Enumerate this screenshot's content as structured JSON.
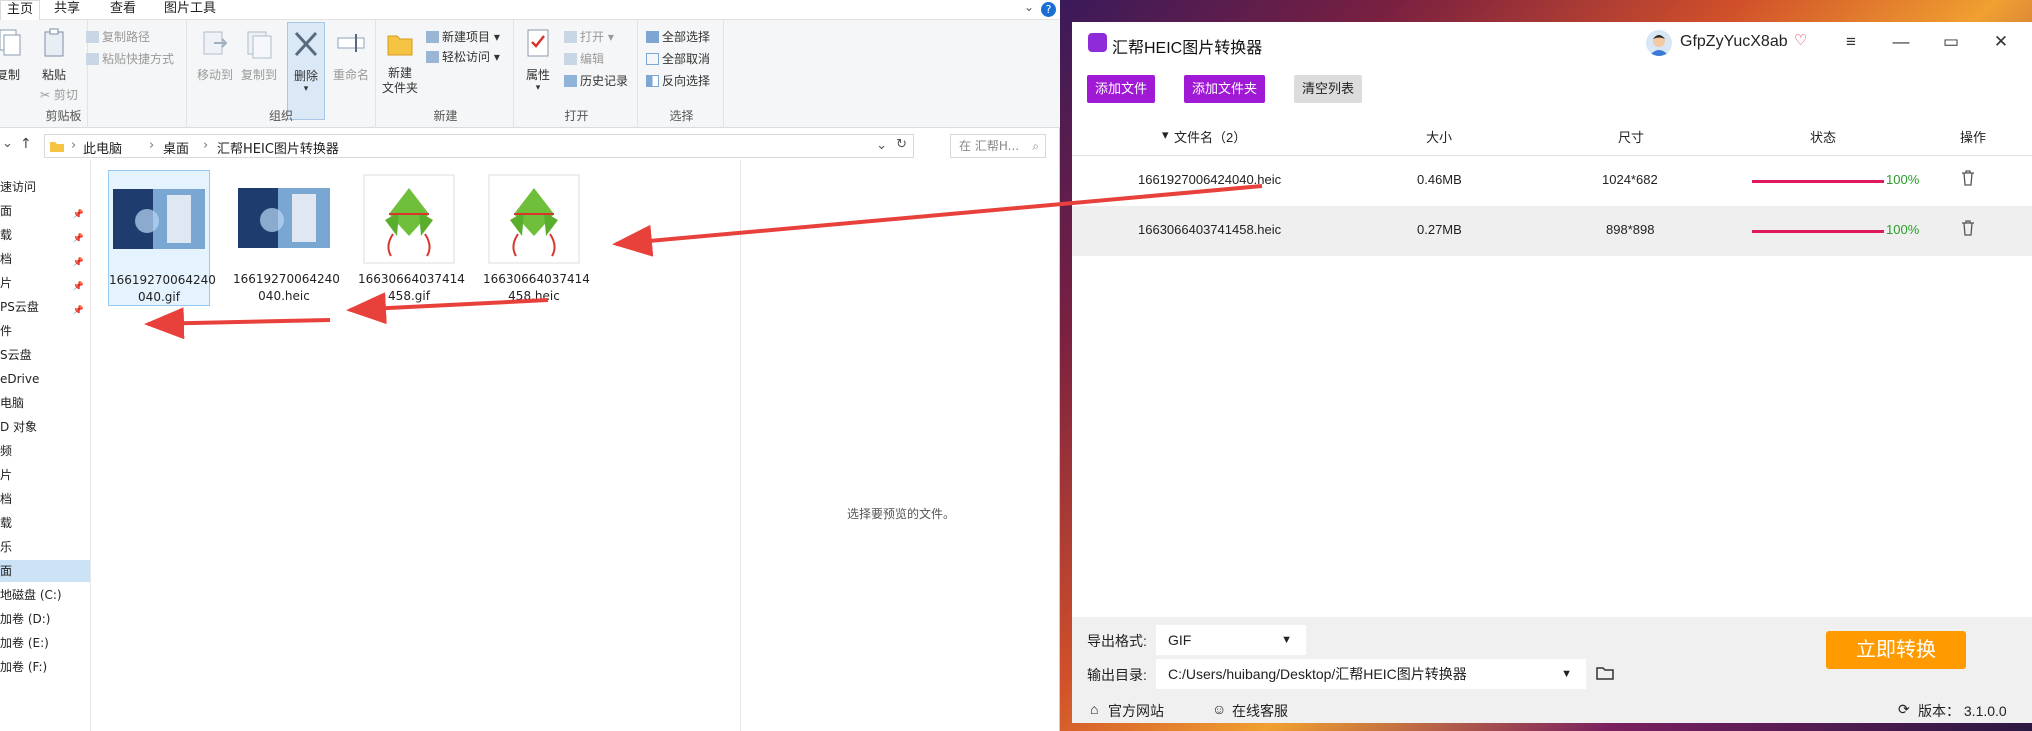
{
  "explorer": {
    "tabs": [
      {
        "label": "主页"
      },
      {
        "label": "共享"
      },
      {
        "label": "查看"
      },
      {
        "label": "图片工具"
      }
    ],
    "ribbon": {
      "clipboard": {
        "copy": "复制",
        "paste": "粘贴",
        "copy_path": "复制路径",
        "paste_shortcut": "粘贴快捷方式",
        "cut": "剪切",
        "group": "剪贴板"
      },
      "organize": {
        "move_to": "移动到",
        "copy_to": "复制到",
        "delete": "删除",
        "rename": "重命名",
        "group": "组织"
      },
      "new": {
        "new_folder": "新建\n文件夹",
        "new_item": "新建项目",
        "easy_access": "轻松访问",
        "group": "新建"
      },
      "open": {
        "properties": "属性",
        "open": "打开",
        "edit": "编辑",
        "history": "历史记录",
        "group": "打开"
      },
      "select": {
        "select_all": "全部选择",
        "select_none": "全部取消",
        "invert": "反向选择",
        "group": "选择"
      }
    },
    "address": {
      "crumbs": [
        "此电脑",
        "桌面",
        "汇帮HEIC图片转换器"
      ],
      "search_placeholder": "在 汇帮H..."
    },
    "nav": [
      {
        "label": "速访问",
        "pinned": false
      },
      {
        "label": "面",
        "pinned": true
      },
      {
        "label": "载",
        "pinned": true
      },
      {
        "label": "档",
        "pinned": true
      },
      {
        "label": "片",
        "pinned": true
      },
      {
        "label": "PS云盘",
        "pinned": true
      },
      {
        "label": "件",
        "pinned": false
      },
      {
        "label": "S云盘",
        "pinned": false
      },
      {
        "label": "eDrive",
        "pinned": false
      },
      {
        "label": "电脑",
        "pinned": false
      },
      {
        "label": "D 对象",
        "pinned": false
      },
      {
        "label": "频",
        "pinned": false
      },
      {
        "label": "片",
        "pinned": false
      },
      {
        "label": "档",
        "pinned": false
      },
      {
        "label": "载",
        "pinned": false
      },
      {
        "label": "乐",
        "pinned": false
      },
      {
        "label": "面",
        "pinned": false
      },
      {
        "label": "地磁盘 (C:)",
        "pinned": false
      },
      {
        "label": "加卷 (D:)",
        "pinned": false
      },
      {
        "label": "加卷 (E:)",
        "pinned": false
      },
      {
        "label": "加卷 (F:)",
        "pinned": false
      }
    ],
    "files": [
      {
        "name1": "16619270064240",
        "name2": "040.gif",
        "kind": "photo"
      },
      {
        "name1": "16619270064240",
        "name2": "040.heic",
        "kind": "photo"
      },
      {
        "name1": "16630664037414",
        "name2": "458.gif",
        "kind": "zongzi"
      },
      {
        "name1": "16630664037414",
        "name2": "458.heic",
        "kind": "zongzi"
      }
    ],
    "preview_text": "选择要预览的文件。"
  },
  "app": {
    "title": "汇帮HEIC图片转换器",
    "username": "GfpZyYucX8ab",
    "toolbar": {
      "add_file": "添加文件",
      "add_folder": "添加文件夹",
      "clear_list": "清空列表"
    },
    "columns": {
      "name": "文件名（2）",
      "size": "大小",
      "dims": "尺寸",
      "status": "状态",
      "action": "操作"
    },
    "rows": [
      {
        "name": "1661927006424040.heic",
        "size": "0.46MB",
        "dims": "1024*682",
        "progress": "100%"
      },
      {
        "name": "1663066403741458.heic",
        "size": "0.27MB",
        "dims": "898*898",
        "progress": "100%"
      }
    ],
    "export_format_label": "导出格式:",
    "export_format": "GIF",
    "output_dir_label": "输出目录:",
    "output_dir": "C:/Users/huibang/Desktop/汇帮HEIC图片转换器",
    "convert_button": "立即转换",
    "official_site": "官方网站",
    "online_support": "在线客服",
    "version": "版本： 3.1.0.0"
  },
  "colors": {
    "accent_purple": "#a01ad6",
    "convert_orange": "#ff9b00",
    "progress": "#e0185f",
    "percent_green": "#2a9d2a",
    "arrow_red": "#e8413c"
  }
}
